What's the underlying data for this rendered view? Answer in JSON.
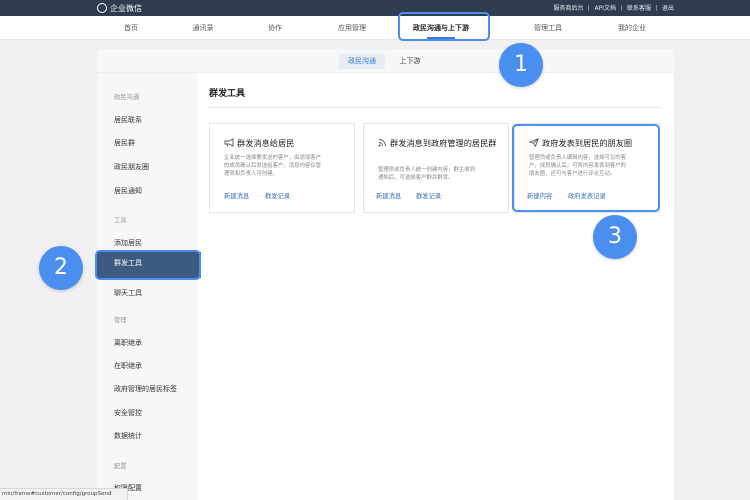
{
  "app": {
    "name": "企业微信",
    "top_links": [
      "服务商后台",
      "API文档",
      "联系客服",
      "退出"
    ]
  },
  "nav": {
    "items": [
      "首页",
      "通讯录",
      "协作",
      "应用管理",
      "政民沟通与上下游",
      "管理工具",
      "我的企业"
    ],
    "active_index": 4
  },
  "subtabs": {
    "items": [
      "政民沟通",
      "上下游"
    ],
    "active_index": 0
  },
  "sidebar": {
    "groups": [
      {
        "label": "政民沟通",
        "items": [
          "居民联系",
          "居民群",
          "政民朋友圈",
          "居民通知"
        ]
      },
      {
        "label": "工具",
        "items": [
          "添加居民",
          "群发工具",
          "聊天工具"
        ]
      },
      {
        "label": "管理",
        "items": [
          "离职继承",
          "在职继承",
          "政府管理的居民标签",
          "安全管控",
          "数据统计"
        ]
      },
      {
        "label": "配置",
        "items": [
          "权限配置"
        ]
      }
    ],
    "active_item": "群发工具"
  },
  "main": {
    "title": "群发工具",
    "cards": [
      {
        "icon": "megaphone-icon",
        "title": "群发消息给居民",
        "desc_lines": [
          "企业统一选择要发送的客户，由添加客户",
          "的成员确认后发送给客户。消息内容仅管",
          "理员和负责人可创建。"
        ],
        "links": [
          "新建消息",
          "群发记录"
        ]
      },
      {
        "icon": "broadcast-icon",
        "title": "群发消息到政府管理的居民群",
        "desc_lines": [
          "管理员或负责人统一创建内容，群主收到",
          "通知后，可选择客户群并群发。"
        ],
        "links": [
          "新建消息",
          "群发记录"
        ]
      },
      {
        "icon": "paper-plane-icon",
        "title": "政府发表到居民的朋友圈",
        "desc_lines": [
          "管理员或负责人编辑内容，选择可见的客",
          "户，成员确认后，可将内容发表到客户的",
          "朋友圈，还可与客户进行评论互动。"
        ],
        "links": [
          "新建内容",
          "政府发表记录"
        ]
      }
    ]
  },
  "annotations": {
    "badges": [
      "1",
      "2",
      "3"
    ],
    "color": "#4a8ff0"
  },
  "status_url": "min/frame#customer/config/groupSend",
  "colors": {
    "topbar": "#2f3b4e",
    "accent": "#3a7bd5",
    "sidebar_active": "#3d5a80",
    "link": "#3a6fb5"
  }
}
